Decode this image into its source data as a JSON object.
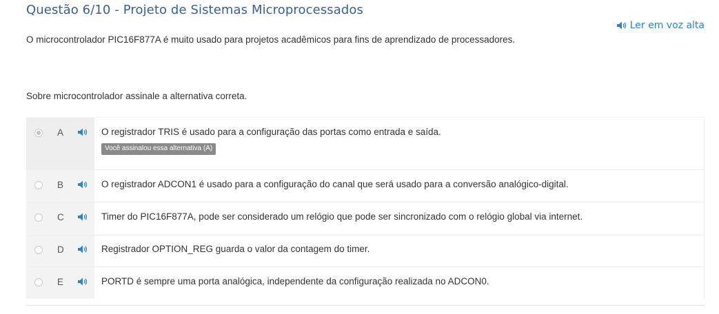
{
  "header": {
    "title": "Questão 6/10 - Projeto de Sistemas Microprocessados",
    "read_aloud_label": "Ler em voz alta"
  },
  "content": {
    "intro": "O microcontrolador PIC16F877A é muito usado para projetos acadêmicos para fins de aprendizado de processadores.",
    "question": "Sobre microcontrolador assinale a alternativa correta."
  },
  "options": [
    {
      "letter": "A",
      "text": "O registrador TRIS é usado para a configuração das portas como entrada e saída.",
      "selected": true,
      "badge": "Você assinalou essa alternativa (A)"
    },
    {
      "letter": "B",
      "text": "O registrador ADCON1 é usado para a configuração do canal que será usado para a conversão analógico-digital.",
      "selected": false
    },
    {
      "letter": "C",
      "text": "Timer do PIC16F877A, pode ser considerado um relógio que pode ser sincronizado com o relógio global via internet.",
      "selected": false
    },
    {
      "letter": "D",
      "text": "Registrador OPTION_REG guarda o valor da contagem do timer.",
      "selected": false
    },
    {
      "letter": "E",
      "text": "PORTD é sempre uma porta analógica, independente da configuração realizada no ADCON0.",
      "selected": false
    }
  ],
  "colors": {
    "title": "#3a5f8f",
    "link": "#2b86c5",
    "badge_bg": "#8a8a8a"
  },
  "icons": {
    "speaker": "speaker-icon"
  }
}
